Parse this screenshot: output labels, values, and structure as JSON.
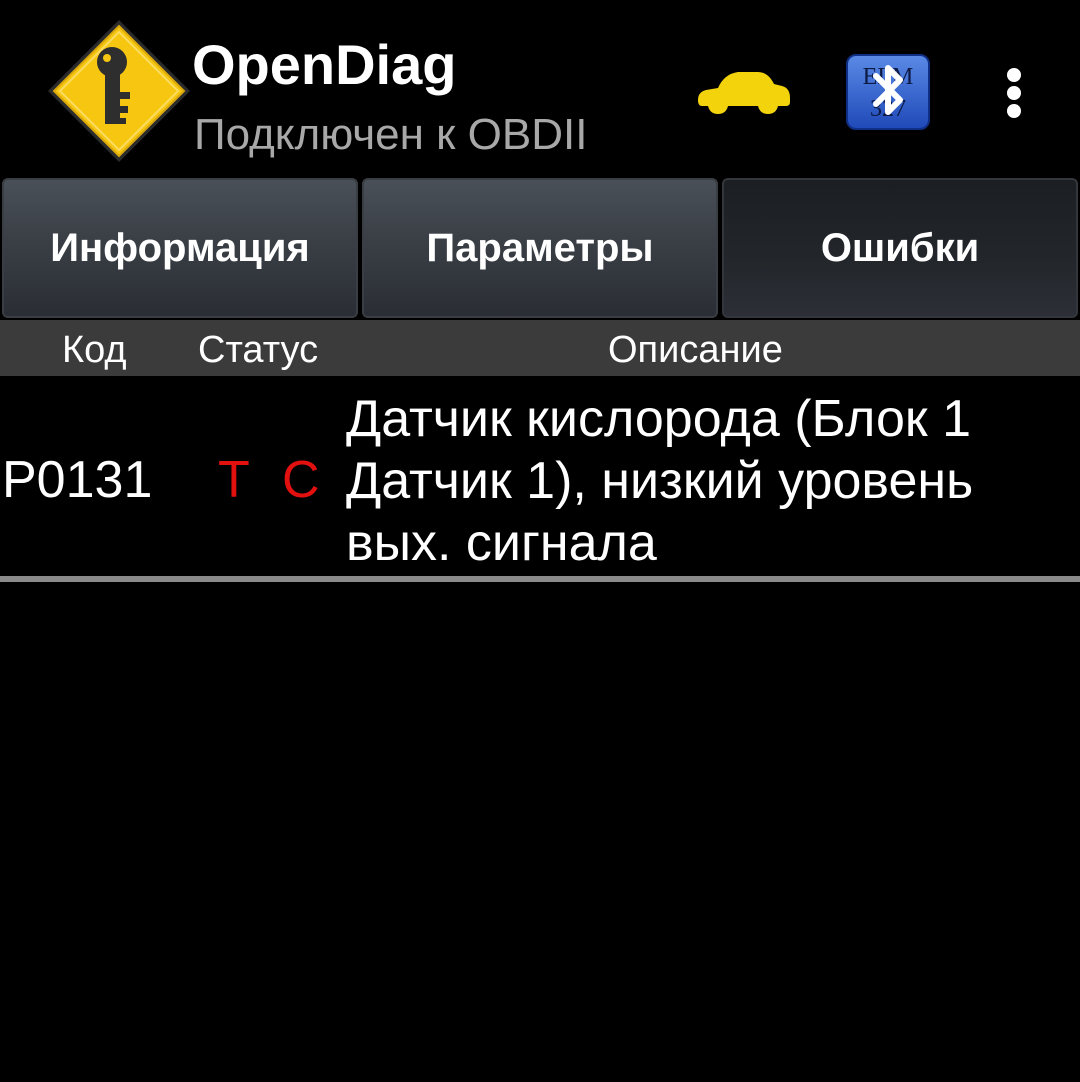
{
  "app": {
    "title": "OpenDiag",
    "subtitle": "Подключен к OBDII",
    "elm_badge_top": "ELM",
    "elm_badge_bottom": "327"
  },
  "colors": {
    "car_icon": "#f2d30c",
    "logo_diamond": "#f6c611",
    "status_red": "#e31010",
    "header_bg": "#3b3b3b",
    "divider": "#8a8a8a"
  },
  "icons": {
    "logo": "key-diamond-icon",
    "car": "car-icon",
    "adapter": "elm327-bluetooth-icon",
    "menu": "overflow-menu-icon"
  },
  "tabs": [
    {
      "label": "Информация",
      "active": false
    },
    {
      "label": "Параметры",
      "active": false
    },
    {
      "label": "Ошибки",
      "active": true
    }
  ],
  "table": {
    "headers": {
      "code": "Код",
      "status": "Статус",
      "description": "Описание"
    },
    "rows": [
      {
        "code": "P0131",
        "status_t": "T",
        "status_c": "C",
        "description": "Датчик кислорода (Блок 1 Датчик 1), низкий уровень вых. сигнала"
      }
    ]
  }
}
